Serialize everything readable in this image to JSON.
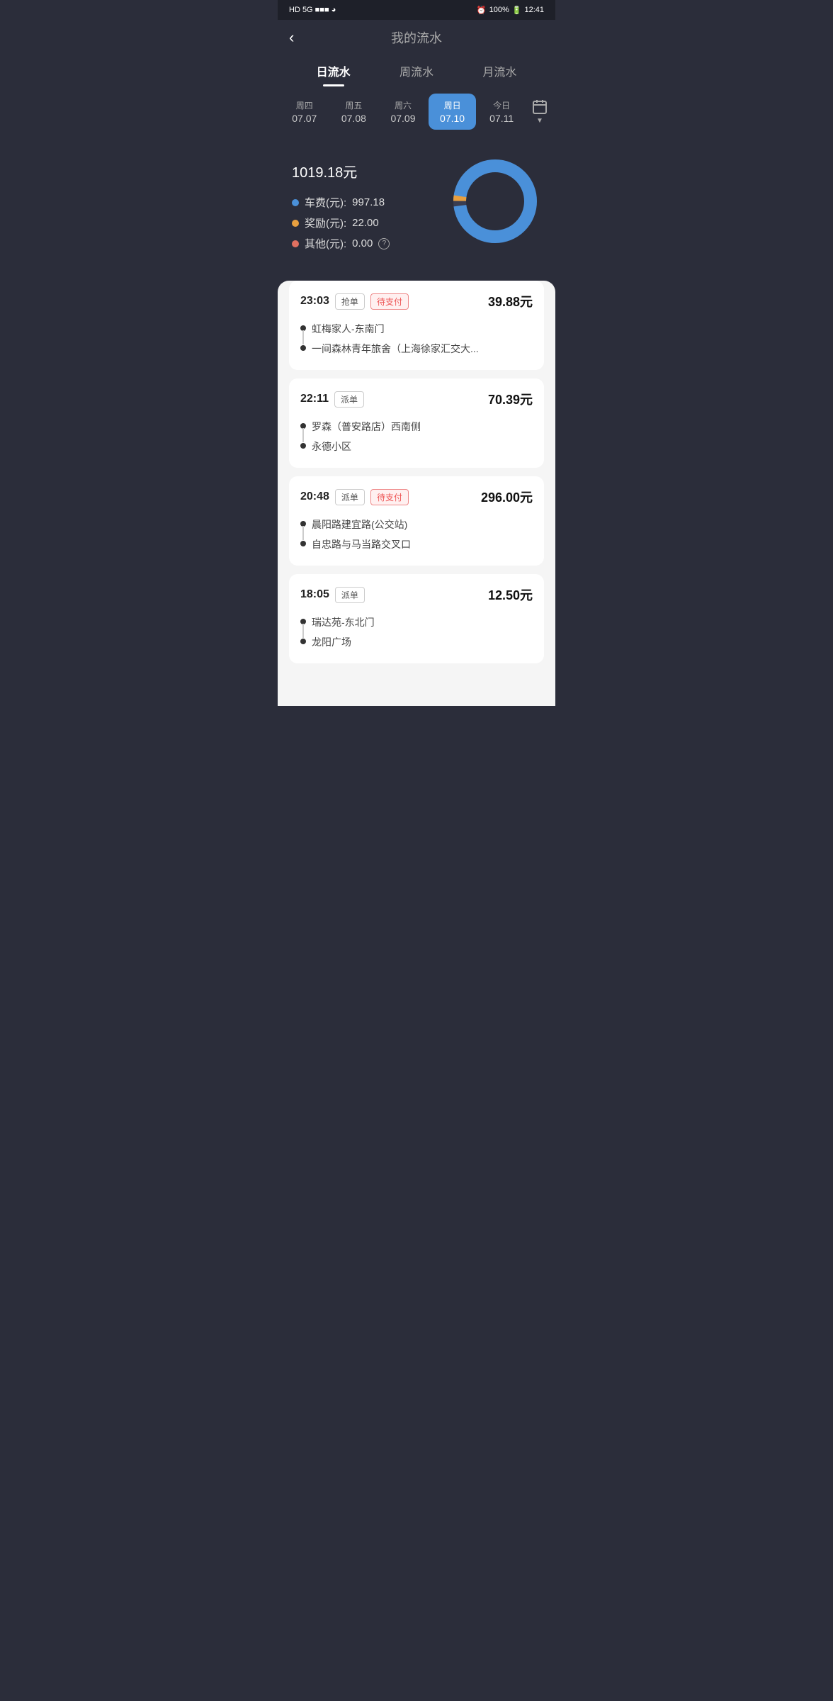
{
  "statusBar": {
    "left": "HD 5G",
    "battery": "100%",
    "time": "12:41"
  },
  "header": {
    "backLabel": "‹",
    "title": "我的流水"
  },
  "tabs": [
    {
      "id": "daily",
      "label": "日流水",
      "active": true
    },
    {
      "id": "weekly",
      "label": "周流水",
      "active": false
    },
    {
      "id": "monthly",
      "label": "月流水",
      "active": false
    }
  ],
  "days": [
    {
      "id": "thu",
      "label": "周四",
      "date": "07.07",
      "active": false
    },
    {
      "id": "fri",
      "label": "周五",
      "date": "07.08",
      "active": false
    },
    {
      "id": "sat",
      "label": "周六",
      "date": "07.09",
      "active": false
    },
    {
      "id": "sun",
      "label": "周日",
      "date": "07.10",
      "active": true
    },
    {
      "id": "today",
      "label": "今日",
      "date": "07.11",
      "active": false
    }
  ],
  "summary": {
    "amount": "1019.18",
    "unit": "元",
    "items": [
      {
        "id": "fare",
        "label": "车费(元):",
        "value": "997.18",
        "color": "blue"
      },
      {
        "id": "bonus",
        "label": "奖励(元):",
        "value": "22.00",
        "color": "orange"
      },
      {
        "id": "other",
        "label": "其他(元):",
        "value": "0.00",
        "color": "red"
      }
    ],
    "chart": {
      "bluePercent": 97.8,
      "orangePercent": 2.2
    }
  },
  "transactions": [
    {
      "id": "t1",
      "time": "23:03",
      "tag": "抢单",
      "status": "待支付",
      "statusType": "pending",
      "amount": "39.88元",
      "from": "虹梅家人-东南门",
      "to": "一间森林青年旅舍（上海徐家汇交大..."
    },
    {
      "id": "t2",
      "time": "22:11",
      "tag": "派单",
      "status": null,
      "statusType": null,
      "amount": "70.39元",
      "from": "罗森（普安路店）西南侧",
      "to": "永德小区"
    },
    {
      "id": "t3",
      "time": "20:48",
      "tag": "派单",
      "status": "待支付",
      "statusType": "pending",
      "amount": "296.00元",
      "from": "晨阳路建宜路(公交站)",
      "to": "自忠路与马当路交叉口"
    },
    {
      "id": "t4",
      "time": "18:05",
      "tag": "派单",
      "status": null,
      "statusType": null,
      "amount": "12.50元",
      "from": "瑞达苑-东北门",
      "to": "龙阳广场"
    }
  ]
}
